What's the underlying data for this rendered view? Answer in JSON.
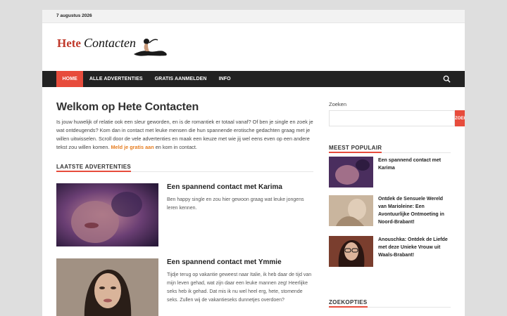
{
  "topbar": {
    "date": "7 augustus 2026"
  },
  "logo": {
    "word1": "Hete",
    "word2": "Contacten"
  },
  "nav": {
    "items": [
      {
        "label": "HOME"
      },
      {
        "label": "ALLE ADVERTENTIES"
      },
      {
        "label": "GRATIS AANMELDEN"
      },
      {
        "label": "INFO"
      }
    ]
  },
  "main": {
    "title": "Welkom op Hete Contacten",
    "intro": "Is jouw huwelijk of relatie ook een sleur geworden, en is de romantiek er totaal vanaf? Of ben je single en zoek je wat ontdeugends? Kom dan in contact met leuke mensen die hun spannende erotische gedachten graag met je willen uitwisselen. Scroll door de vele advertenties en maak een keuze met wie jij wel eens even op een andere tekst zou willen komen.",
    "intro_link": "Meld je gratis aan",
    "intro_end": "en kom in contact.",
    "section_title": "LAATSTE ADVERTENTIES",
    "posts": [
      {
        "title": "Een spannend contact met Karima",
        "excerpt": "Ben happy single en zou hier gewoon graag wat leuke jongens leren kennen."
      },
      {
        "title": "Een spannend contact met Ymmie",
        "excerpt": "Tijdje terug op vakantie geweest naar Italie, ik heb daar de tijd van mijn leven gehad, wat zijn daar een leuke mannen zeg! Heerlijke seks heb ik gehad. Dat mis ik nu wel heel erg, hete, stomende seks. Zullen wij de vakantieseks dunnetjes overdoen?"
      }
    ]
  },
  "sidebar": {
    "search_label": "Zoeken",
    "search_placeholder": "",
    "search_button": "ZOEKEN",
    "popular_title": "MEEST POPULAIR",
    "popular": [
      {
        "title": "Een spannend contact met Karima"
      },
      {
        "title": "Ontdek de Sensuele Wereld van Marioleine: Een Avontuurlijke Ontmoeting in Noord-Brabant!"
      },
      {
        "title": "Anouschka: Ontdek de Liefde met deze Unieke Vrouw uit Waals-Brabant!"
      }
    ],
    "search_options_title": "ZOEKOPTIES"
  },
  "colors": {
    "accent": "#e74c3c",
    "nav_bg": "#222222",
    "link": "#e67e22"
  }
}
